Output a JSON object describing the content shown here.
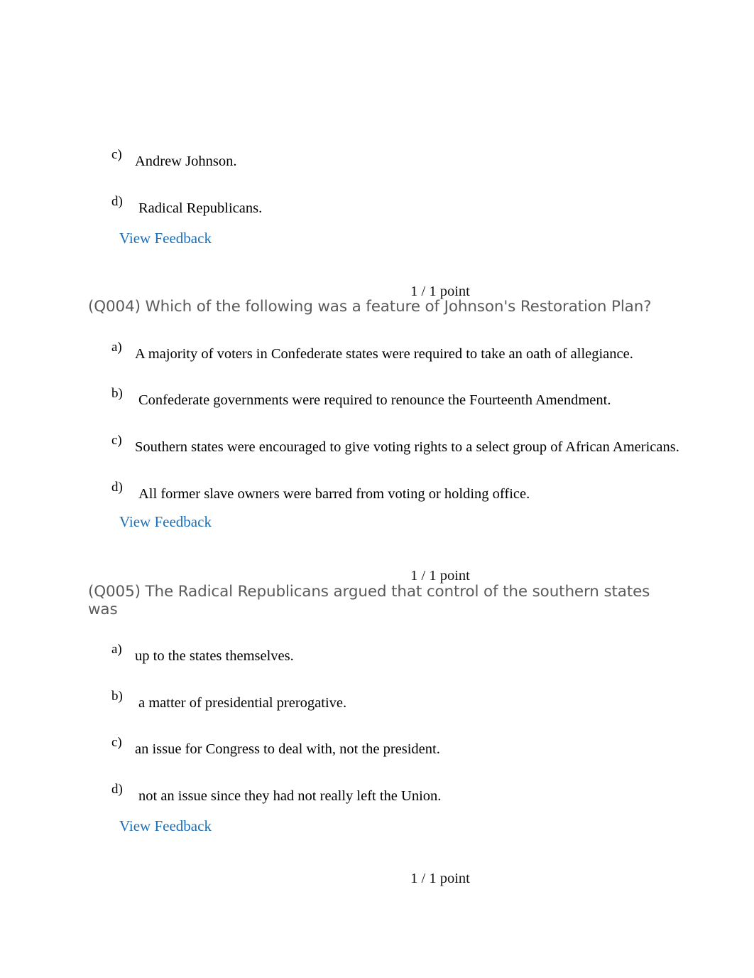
{
  "document": {
    "title": "Quiz Review - Reconstruction",
    "background_color": "#ffffff",
    "link_color": "#1a6fb8",
    "question_text_color": "#5a5b5d",
    "body_text_color": "#000000"
  },
  "feedback_label": "View Feedback",
  "points_label": "1 / 1 point",
  "partial_question_top": {
    "options": [
      {
        "marker": "c)",
        "text": "Andrew Johnson."
      },
      {
        "marker": "d)",
        "text": "Radical Republicans."
      }
    ],
    "feedback": "View Feedback"
  },
  "questions": [
    {
      "id": "Q004",
      "points": "1 / 1 point",
      "prompt_lines": [
        "(Q004) Which of the following was a feature of Johnson's Restoration Plan?"
      ],
      "prompt": "(Q004) Which of the following was a feature of Johnson's Restoration Plan?",
      "options": [
        {
          "marker": "a)",
          "text": "A majority of voters in Confederate states were required to take an oath of allegiance."
        },
        {
          "marker": "b)",
          "text": "Confederate governments were required to renounce the Fourteenth Amendment."
        },
        {
          "marker": "c)",
          "text": "Southern states were encouraged to give voting rights to a select group of African Americans."
        },
        {
          "marker": "d)",
          "text": "All former slave owners were barred from voting or holding office."
        }
      ],
      "feedback": "View Feedback"
    },
    {
      "id": "Q005",
      "points": "1 / 1 point",
      "prompt_lines": [
        "(Q005) The Radical Republicans argued that control of the southern states",
        "was"
      ],
      "prompt": "(Q005) The Radical Republicans argued that control of the southern states was",
      "options": [
        {
          "marker": "a)",
          "text": "up to the states themselves."
        },
        {
          "marker": "b)",
          "text": "a matter of presidential prerogative."
        },
        {
          "marker": "c)",
          "text": "an issue for Congress to deal with, not the president."
        },
        {
          "marker": "d)",
          "text": "not an issue since they had not really left the Union."
        }
      ],
      "feedback": "View Feedback"
    }
  ],
  "next_question_points": "1 / 1 point"
}
